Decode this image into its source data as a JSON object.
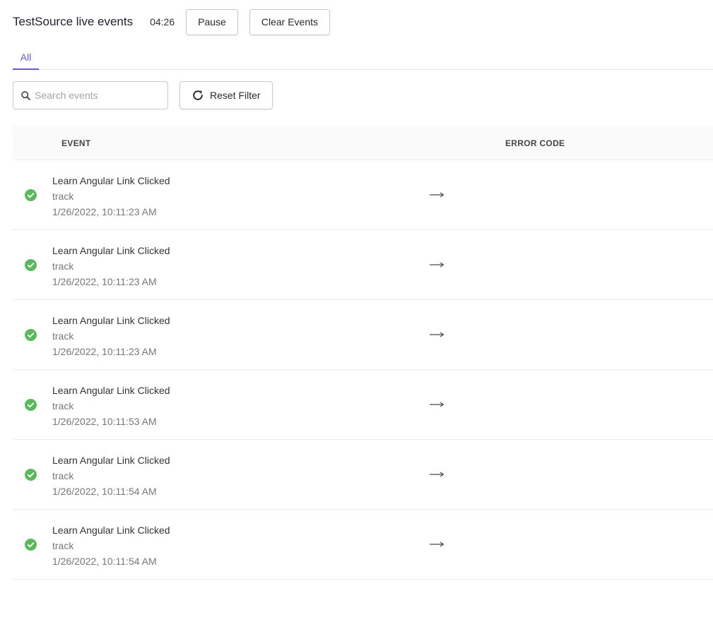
{
  "header": {
    "title": "TestSource live events",
    "timer": "04:26",
    "pause_label": "Pause",
    "clear_label": "Clear Events"
  },
  "tabs": [
    {
      "label": "All",
      "active": true
    }
  ],
  "filter": {
    "search_placeholder": "Search events",
    "search_value": "",
    "reset_label": "Reset Filter"
  },
  "table": {
    "columns": [
      "EVENT",
      "ERROR CODE"
    ],
    "rows": [
      {
        "status": "success",
        "name": "Learn Angular Link Clicked",
        "type": "track",
        "time": "1/26/2022, 10:11:23 AM"
      },
      {
        "status": "success",
        "name": "Learn Angular Link Clicked",
        "type": "track",
        "time": "1/26/2022, 10:11:23 AM"
      },
      {
        "status": "success",
        "name": "Learn Angular Link Clicked",
        "type": "track",
        "time": "1/26/2022, 10:11:23 AM"
      },
      {
        "status": "success",
        "name": "Learn Angular Link Clicked",
        "type": "track",
        "time": "1/26/2022, 10:11:53 AM"
      },
      {
        "status": "success",
        "name": "Learn Angular Link Clicked",
        "type": "track",
        "time": "1/26/2022, 10:11:54 AM"
      },
      {
        "status": "success",
        "name": "Learn Angular Link Clicked",
        "type": "track",
        "time": "1/26/2022, 10:11:54 AM"
      }
    ]
  },
  "icons": {
    "search": "search-icon",
    "reset": "refresh-icon",
    "status": "check-circle-icon",
    "row_action": "arrow-right-icon"
  },
  "colors": {
    "accent": "#6f54c6",
    "success": "#5cb85c",
    "border": "#c9c9c9"
  }
}
